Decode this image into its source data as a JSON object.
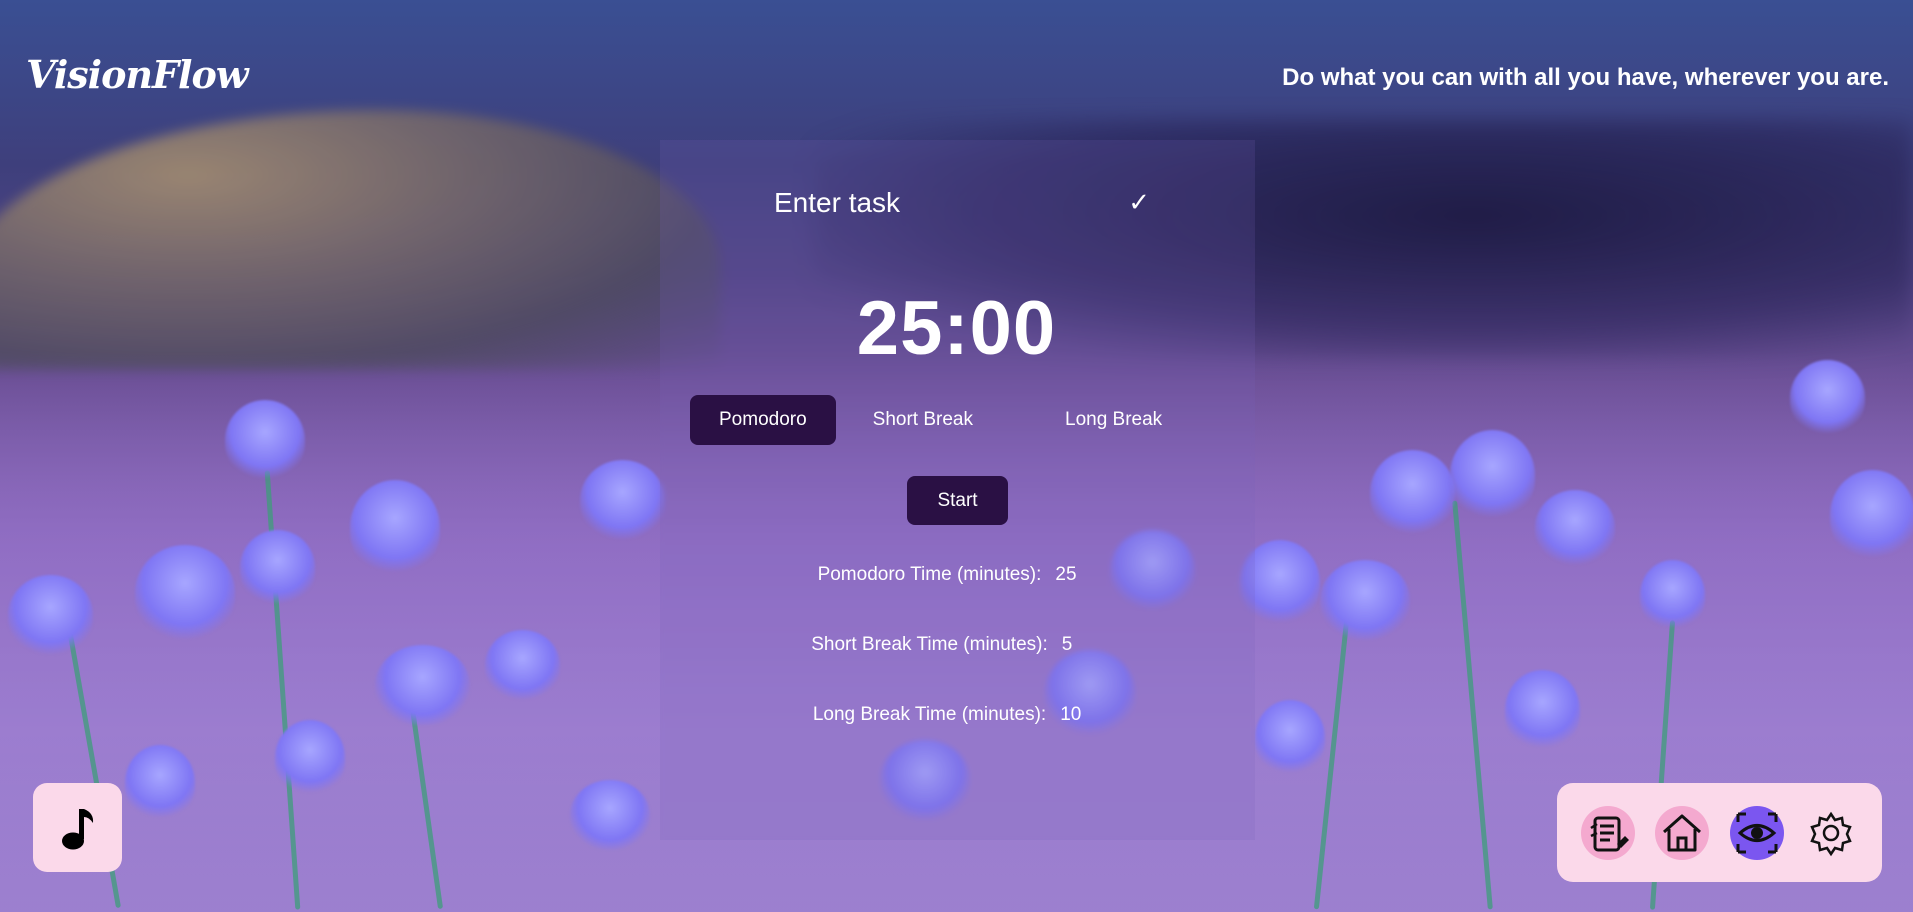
{
  "app": {
    "logo": "VisionFlow",
    "quote": "Do what you can with all you have, wherever you are."
  },
  "task": {
    "placeholder": "Enter task",
    "confirm_icon": "checkmark-icon",
    "confirm_glyph": "✓"
  },
  "timer": {
    "display": "25:00"
  },
  "modes": [
    {
      "label": "Pomodoro",
      "active": true
    },
    {
      "label": "Short Break",
      "active": false
    },
    {
      "label": "Long Break",
      "active": false
    }
  ],
  "controls": {
    "start_label": "Start"
  },
  "settings": [
    {
      "label": "Pomodoro Time (minutes):",
      "value": "25"
    },
    {
      "label": "Short Break Time (minutes):",
      "value": "5"
    },
    {
      "label": "Long Break Time (minutes):",
      "value": "10"
    }
  ],
  "dock": {
    "items": [
      {
        "icon": "notes-icon"
      },
      {
        "icon": "home-icon"
      },
      {
        "icon": "eye-icon",
        "active": true
      },
      {
        "icon": "gear-icon"
      }
    ]
  },
  "music": {
    "icon": "music-note-icon"
  },
  "colors": {
    "accent_dark": "#2a1044",
    "dock_bg": "#fbd9ea",
    "active_purple": "#7b56f0"
  }
}
